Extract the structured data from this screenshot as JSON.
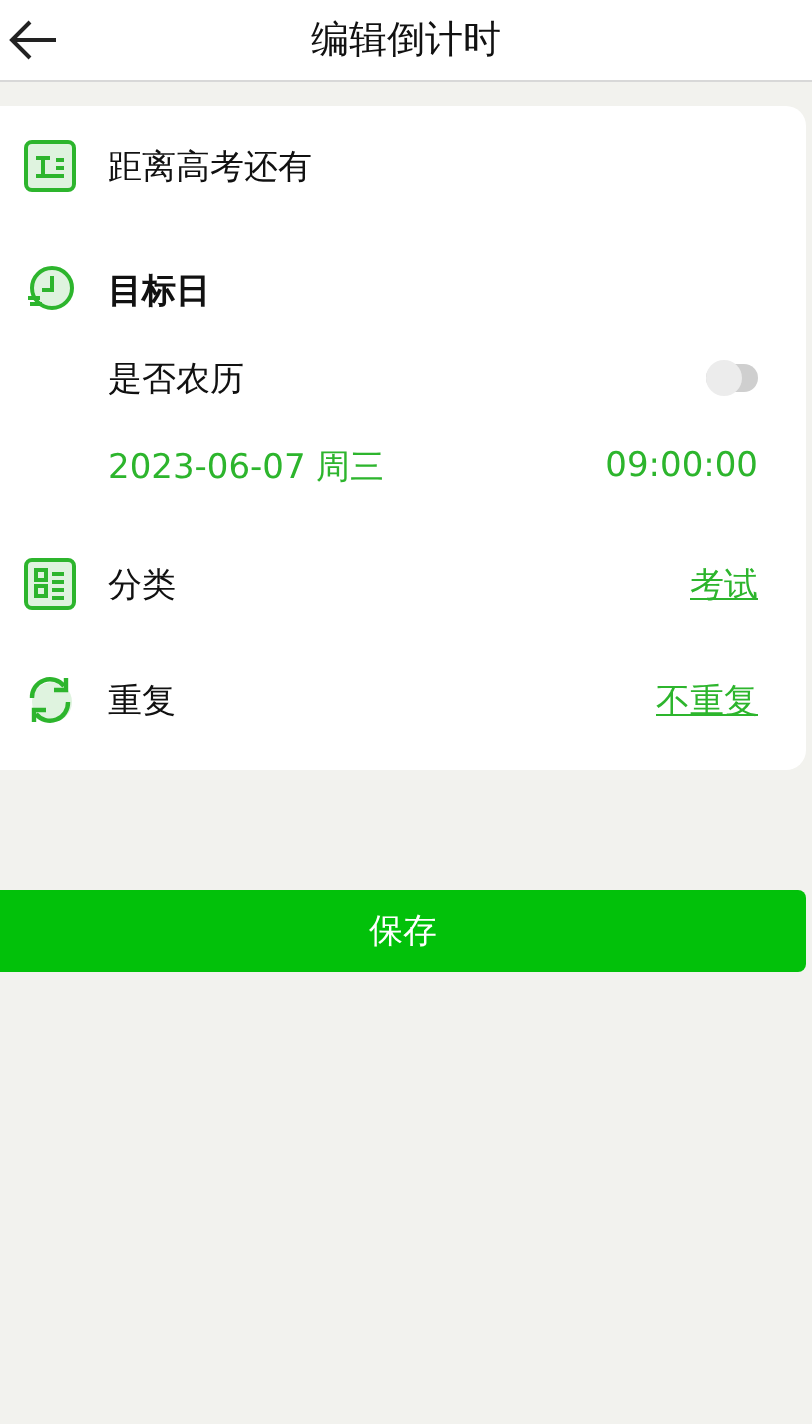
{
  "header": {
    "title": "编辑倒计时"
  },
  "name_field": {
    "value": "距离高考还有"
  },
  "target_date": {
    "label": "目标日",
    "lunar": {
      "label": "是否农历",
      "on": false
    },
    "date": "2023-06-07 周三",
    "time": "09:00:00"
  },
  "settings": [
    {
      "kind": "category",
      "label": "分类",
      "value": "考试"
    },
    {
      "kind": "repeat",
      "label": "重复",
      "value": "不重复"
    }
  ],
  "save_button": {
    "label": "保存"
  }
}
